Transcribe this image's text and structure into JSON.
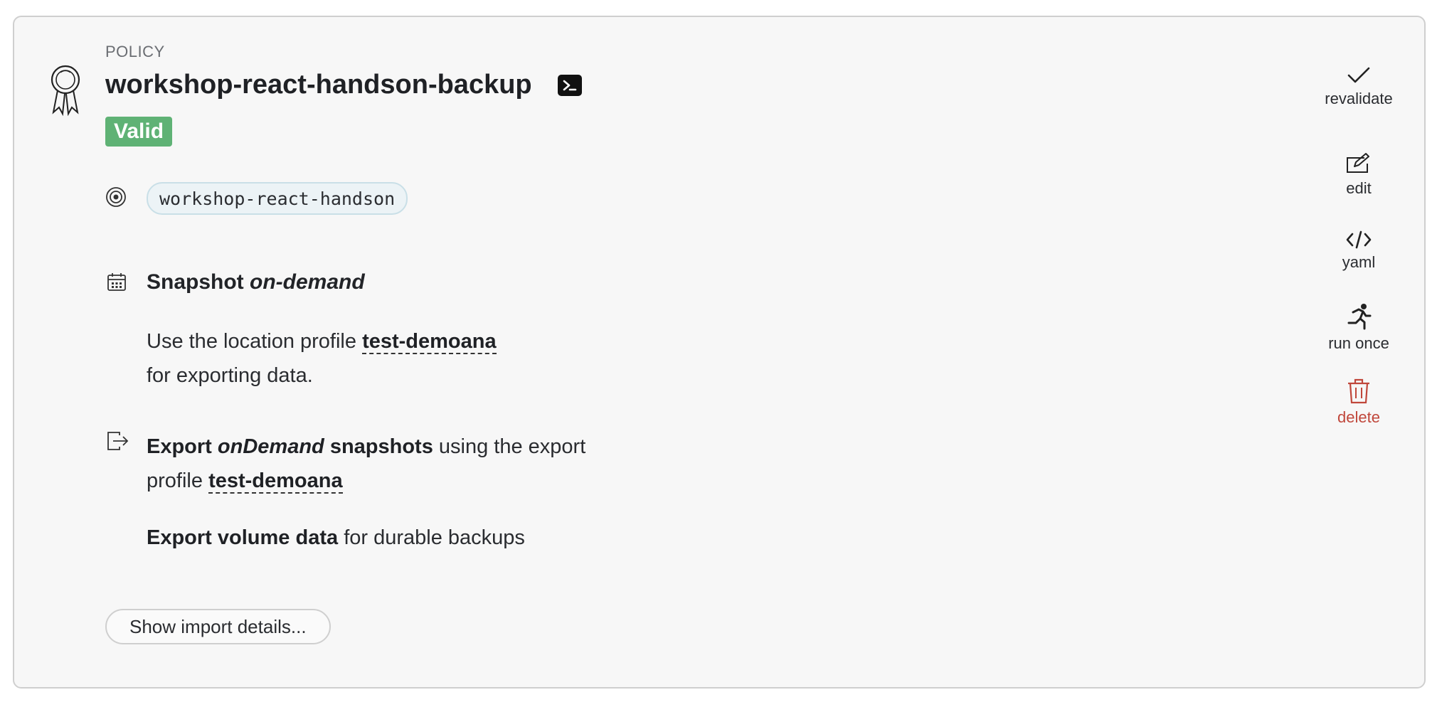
{
  "policy": {
    "kind_label": "POLICY",
    "name": "workshop-react-handson-backup",
    "status": "Valid",
    "status_color": "#5fb275",
    "selector": "workshop-react-handson"
  },
  "snapshot": {
    "heading_bold": "Snapshot",
    "heading_italic": "on-demand",
    "desc_prefix": "Use the location profile",
    "location_profile": "test-demoana",
    "desc_suffix": "for exporting data."
  },
  "export": {
    "prefix_bold": "Export",
    "frequency_italic": "onDemand",
    "snapshots_bold": "snapshots",
    "using_text": "using the export profile",
    "export_profile": "test-demoana",
    "volume_bold": "Export volume data",
    "volume_suffix": "for durable backups"
  },
  "buttons": {
    "show_import": "Show import details..."
  },
  "actions": {
    "revalidate": "revalidate",
    "edit": "edit",
    "yaml": "yaml",
    "run_once": "run once",
    "delete": "delete",
    "delete_color": "#c0473b"
  },
  "icons": {
    "policy": "award-ribbon-icon",
    "terminal": "terminal-icon",
    "selector": "target-icon",
    "snapshot": "calendar-icon",
    "export": "export-icon",
    "revalidate": "check-icon",
    "edit": "edit-icon",
    "yaml": "code-icon",
    "run_once": "running-person-icon",
    "delete": "trash-icon"
  }
}
